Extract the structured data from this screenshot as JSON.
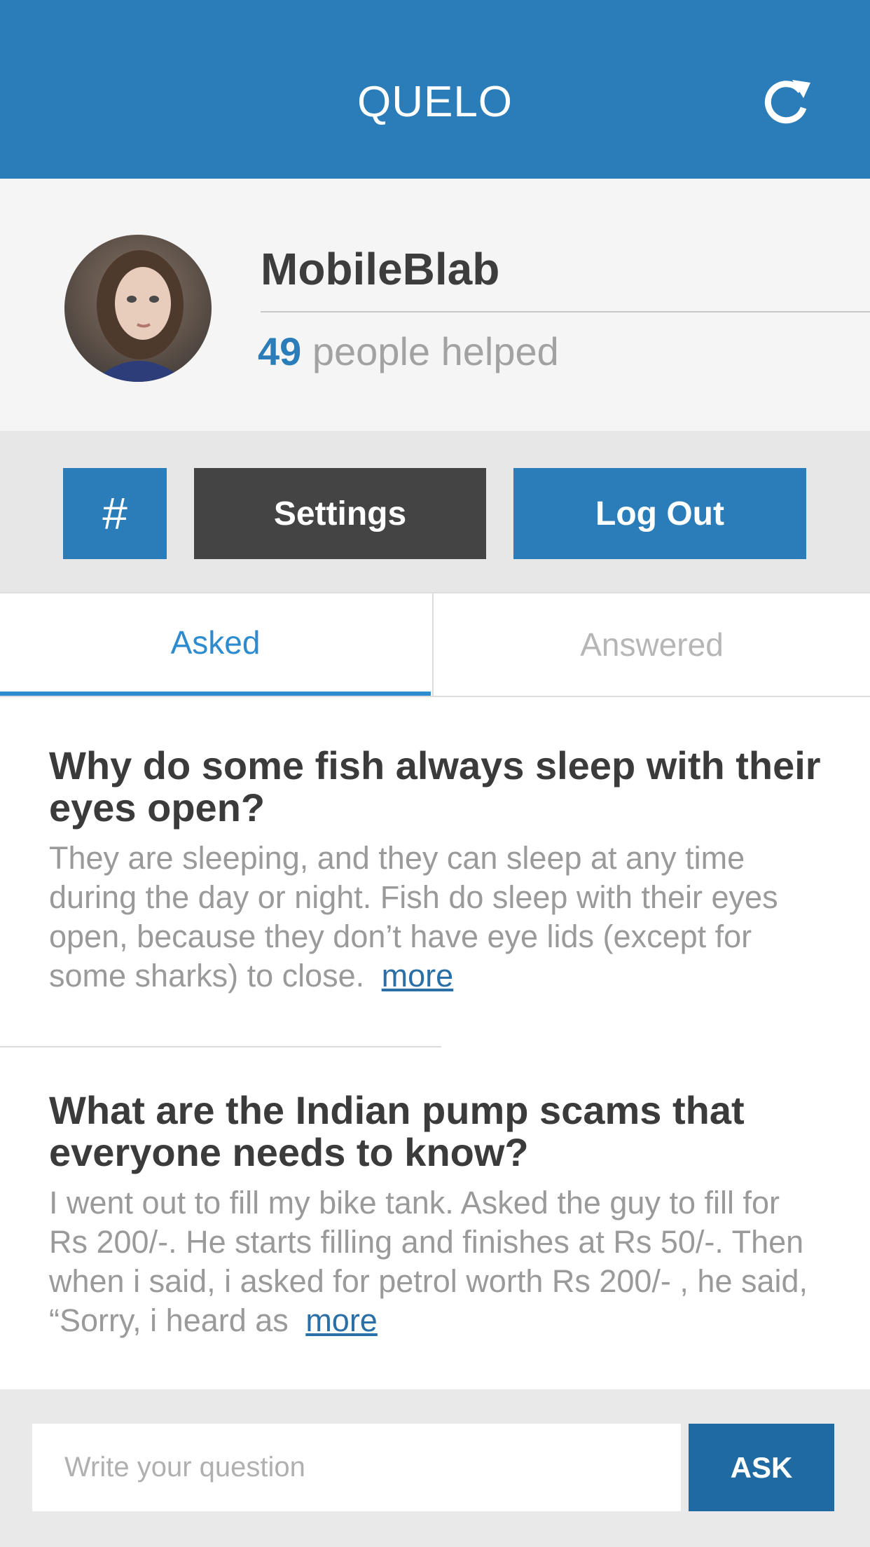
{
  "header": {
    "title": "QUELO",
    "refresh_icon": "refresh-icon"
  },
  "profile": {
    "username": "MobileBlab",
    "helped_count": "49",
    "helped_label": "people helped",
    "avatar_icon": "user-avatar"
  },
  "actions": {
    "hash_label": "#",
    "settings_label": "Settings",
    "logout_label": "Log Out"
  },
  "tabs": [
    {
      "label": "Asked",
      "active": true
    },
    {
      "label": "Answered",
      "active": false
    }
  ],
  "questions": [
    {
      "title": "Why do some fish always sleep with their eyes open?",
      "excerpt": "They are sleeping, and they can sleep at any time during the day or night. Fish do sleep with their eyes open, because they don’t have eye lids (except for some sharks) to close.",
      "more_label": "more"
    },
    {
      "title": "What are the Indian pump scams that everyone needs to know?",
      "excerpt": "I went out to fill my bike tank. Asked the guy to fill for Rs 200/-. He starts filling and finishes at Rs 50/-. Then when i said, i asked for petrol worth Rs 200/- , he said, “Sorry, i heard as",
      "more_label": "more"
    }
  ],
  "composer": {
    "placeholder": "Write your question",
    "value": "",
    "ask_label": "ASK"
  },
  "colors": {
    "primary": "#2a7db8",
    "dark_button": "#444444",
    "active_tab": "#2d8ccf",
    "ask_button": "#1f6aa3"
  }
}
